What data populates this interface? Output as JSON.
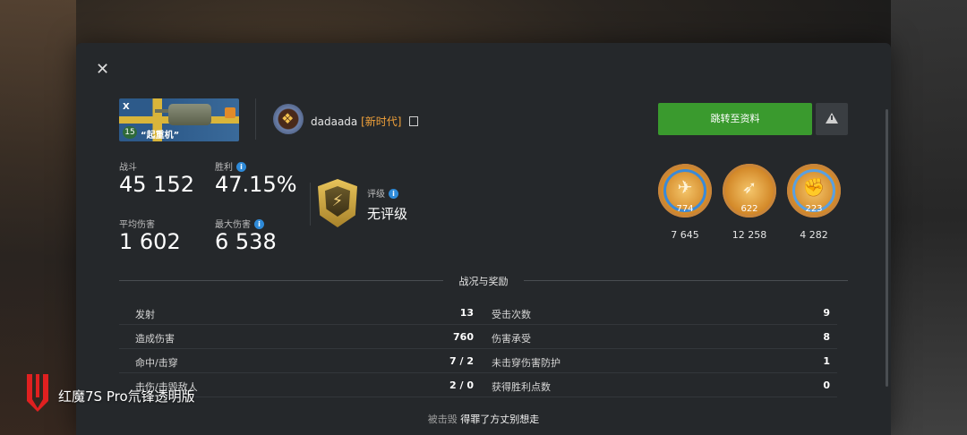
{
  "vehicle": {
    "tier_badge": "X",
    "level": "15",
    "name": "“起重机”"
  },
  "player": {
    "name": "dadaada",
    "clan_tag": "[新时代]"
  },
  "stats": {
    "battles_label": "战斗",
    "battles_value": "45 152",
    "winrate_label": "胜利",
    "winrate_value": "47.15%",
    "avg_damage_label": "平均伤害",
    "avg_damage_value": "1 602",
    "max_damage_label": "最大伤害",
    "max_damage_value": "6 538"
  },
  "rating": {
    "label": "评级",
    "value": "无评级"
  },
  "actions": {
    "profile_button": "跳转至资料"
  },
  "medals": [
    {
      "icon": "cannon-medal-icon",
      "badge": "774",
      "count": "7 645"
    },
    {
      "icon": "crossbow-medal-icon",
      "badge": "622",
      "count": "12 258"
    },
    {
      "icon": "fist-medal-icon",
      "badge": "223",
      "count": "4 282"
    }
  ],
  "section": {
    "title": "战况与奖励"
  },
  "battle_stats_left": [
    {
      "label": "发射",
      "value": "13"
    },
    {
      "label": "造成伤害",
      "value": "760"
    },
    {
      "label": "命中/击穿",
      "value": "7 / 2"
    },
    {
      "label": "击伤/击毁敌人",
      "value": "2 / 0"
    }
  ],
  "battle_stats_right": [
    {
      "label": "受击次数",
      "value": "9"
    },
    {
      "label": "伤害承受",
      "value": "8"
    },
    {
      "label": "未击穿伤害防护",
      "value": "1"
    },
    {
      "label": "获得胜利点数",
      "value": "0"
    }
  ],
  "footer": {
    "destroyed_by_label": "被击毁",
    "destroyed_by_name": "得罪了方丈别想走"
  },
  "watermark": {
    "text": "红魔7S Pro氘锋透明版"
  },
  "colors": {
    "accent_green": "#3a9a2e",
    "clan_orange": "#f2a23a",
    "info_blue": "#2e8ad8",
    "panel": "#25282b"
  }
}
